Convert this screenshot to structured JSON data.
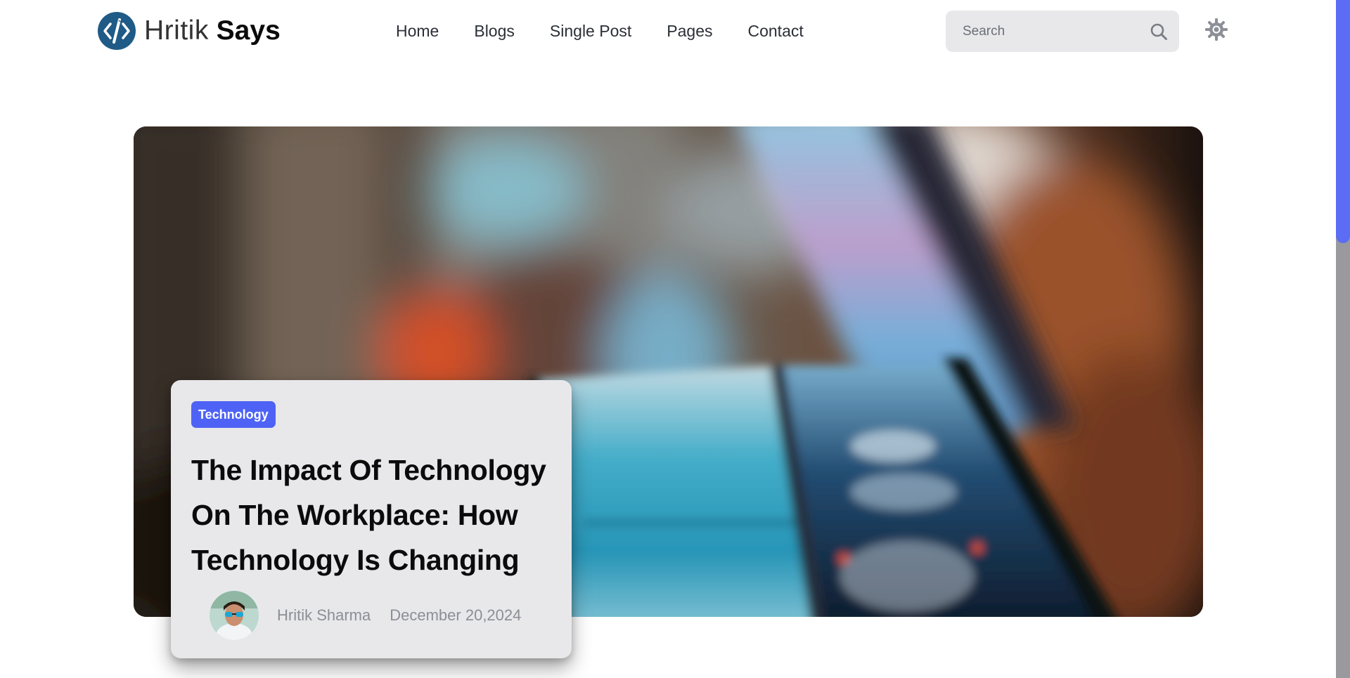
{
  "brand": {
    "name_light": "Hritik",
    "name_bold": "Says",
    "logo_color": "#1f5b86"
  },
  "nav": {
    "items": [
      {
        "label": "Home"
      },
      {
        "label": "Blogs"
      },
      {
        "label": "Single Post"
      },
      {
        "label": "Pages"
      },
      {
        "label": "Contact"
      }
    ]
  },
  "search": {
    "placeholder": "Search",
    "value": "",
    "icon": "search-icon"
  },
  "theme_toggle": {
    "icon": "sun-icon"
  },
  "hero": {
    "image_icon": "hero-image",
    "post": {
      "category": "Technology",
      "category_color": "#4e63f5",
      "title": "The Impact Of Technology On The Workplace: How Technology Is Changing",
      "author": "Hritik Sharma",
      "date": "December 20,2024"
    }
  },
  "scrollbar": {
    "thumb_color": "#5b6cf5",
    "track_color": "#9a9a9e"
  }
}
